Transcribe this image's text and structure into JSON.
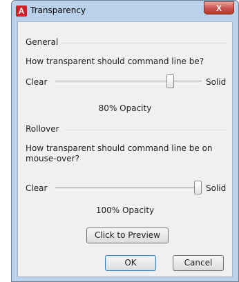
{
  "window": {
    "title": "Transparency",
    "close_label": "X"
  },
  "general": {
    "group_label": "General",
    "question": "How transparent should command line be?",
    "min_label": "Clear",
    "max_label": "Solid",
    "opacity_value": 0.8,
    "opacity_text": "80% Opacity"
  },
  "rollover": {
    "group_label": "Rollover",
    "question": "How transparent should command line be on mouse-over?",
    "min_label": "Clear",
    "max_label": "Solid",
    "opacity_value": 1.0,
    "opacity_text": "100% Opacity"
  },
  "buttons": {
    "preview": "Click to Preview",
    "ok": "OK",
    "cancel": "Cancel"
  },
  "icons": {
    "app": "autocad-icon",
    "close": "close-icon"
  }
}
